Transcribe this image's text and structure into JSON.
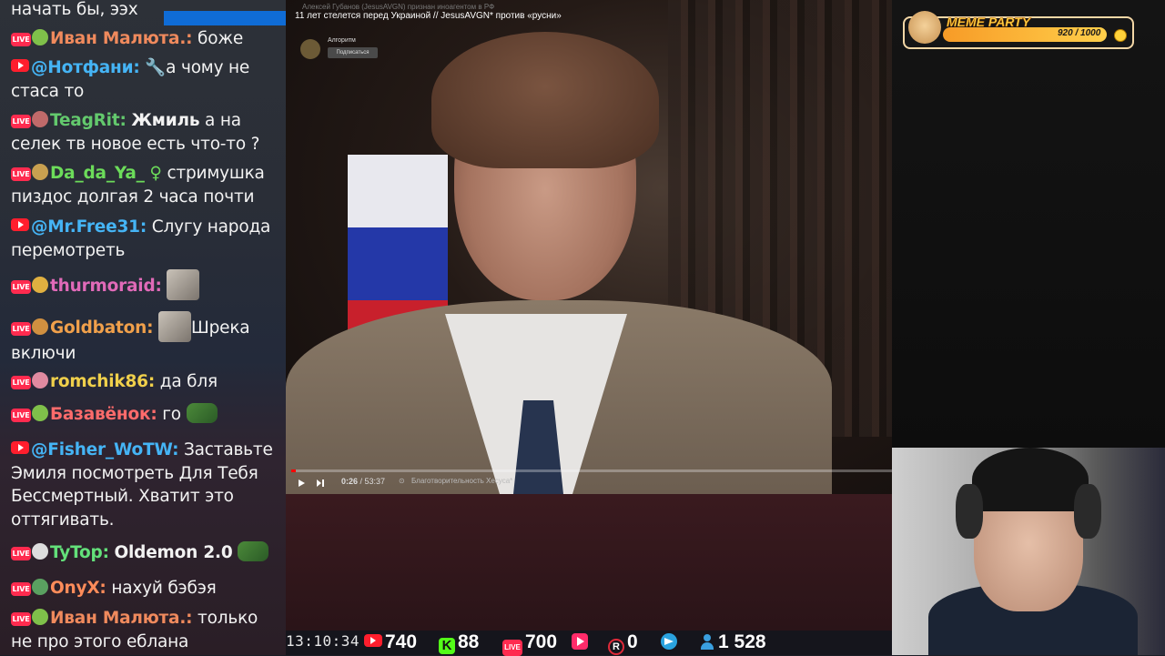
{
  "chat": {
    "top_fragment": "начать бы, ээх",
    "messages": [
      {
        "platform": "live",
        "nick": "Иван Малюта.:",
        "nick_color": "#f08a5d",
        "text": "боже"
      },
      {
        "platform": "yt",
        "nick": "@Нотфани:",
        "nick_color": "#45b4f5",
        "text": "а чому не стаса то"
      },
      {
        "platform": "live",
        "nick": "TeagRit:",
        "nick_color": "#63c96d",
        "bold": "Жмиль",
        "text": "а на селек тв новое есть что-то ?"
      },
      {
        "platform": "live",
        "nick": "Da_da_Ya_",
        "nick_color": "#6cdc5a",
        "text": "стримушка пиздос долгая 2 часа почти"
      },
      {
        "platform": "yt",
        "nick": "@Mr.Free31:",
        "nick_color": "#45b4f5",
        "text": "Слугу народа перемотреть"
      },
      {
        "platform": "live",
        "nick": "thurmoraid:",
        "nick_color": "#e06ab8",
        "text": ""
      },
      {
        "platform": "live",
        "nick": "Goldbaton:",
        "nick_color": "#f0a04b",
        "text": "Шрека включи"
      },
      {
        "platform": "live",
        "nick": "romchik86:",
        "nick_color": "#f0d04b",
        "text": "да бля"
      },
      {
        "platform": "live",
        "nick": "Базавёнок:",
        "nick_color": "#ff6b6b",
        "text": "го"
      },
      {
        "platform": "yt",
        "nick": "@Fisher_WoTW:",
        "nick_color": "#45b4f5",
        "text": "Заставьте Эмиля посмотреть Для Тебя Бессмертный. Хватит это оттягивать."
      },
      {
        "platform": "live",
        "nick": "TyTop:",
        "nick_color": "#63e07a",
        "bold": "Oldemon 2.0",
        "text": ""
      },
      {
        "platform": "live",
        "nick": "OnyX:",
        "nick_color": "#ff8c5a",
        "text": "нахуй бэбэя"
      },
      {
        "platform": "live",
        "nick": "Иван Малюта.:",
        "nick_color": "#f08a5d",
        "text": "только не про этого еблана"
      }
    ],
    "live_badge": "LIVE"
  },
  "video": {
    "subtitle": "Алексей Губанов (JesusAVGN) признан иноагентом в РФ",
    "title": "11 лет стелется перед Украиной // JesusAVGN* против «русни»",
    "channel": "Алгоритм",
    "subscribe": "Подписаться",
    "time_current": "0:26",
    "time_total": "53:37",
    "chapter": "Благотворительность Хесуса*",
    "progress_fraction": 0.008
  },
  "meme_party": {
    "title": "MEME PARTY",
    "count": "920 / 1000",
    "fraction": 0.92
  },
  "stats": {
    "time": "13:10:34",
    "youtube": "740",
    "kick": "88",
    "live": "700",
    "rutube": "",
    "r": "0",
    "telegram": "",
    "viewers": "1 528",
    "kick_letter": "K",
    "live_label": "LIVE",
    "r_letter": "R"
  }
}
